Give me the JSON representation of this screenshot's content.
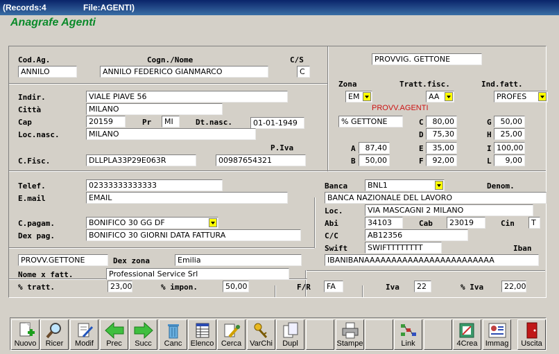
{
  "window": {
    "records": "(Records:4",
    "file": "File:AGENTI)"
  },
  "app_title": "Anagrafe Agenti",
  "labels": {
    "cod_ag": "Cod.Ag.",
    "cognome_nome": "Cogn./Nome",
    "cs": "C/S",
    "indir": "Indir.",
    "citta": "Città",
    "cap": "Cap",
    "pr": "Pr",
    "dt_nasc": "Dt.nasc.",
    "loc_nasc": "Loc.nasc.",
    "piva": "P.Iva",
    "cfisc": "C.Fisc.",
    "telef": "Telef.",
    "email": "E.mail",
    "cpagam": "C.pagam.",
    "dex_pag": "Dex pag.",
    "dex_zona": "Dex zona",
    "nome_fatt": "Nome x fatt.",
    "tratt": "% tratt.",
    "impon": "% impon.",
    "fr": "F/R",
    "iva": "Iva",
    "perc_iva": "% Iva",
    "zona": "Zona",
    "tratt_fisc": "Tratt.fisc.",
    "ind_fatt": "Ind.fatt.",
    "provv_agenti": "PROVV.AGENTI",
    "A": "A",
    "B": "B",
    "C": "C",
    "D": "D",
    "E": "E",
    "F": "F",
    "G": "G",
    "H": "H",
    "I": "I",
    "L": "L",
    "banca": "Banca",
    "denom": "Denom.",
    "loc": "Loc.",
    "abi": "Abi",
    "cab": "Cab",
    "cin": "Cin",
    "cc": "C/C",
    "swift": "Swift",
    "iban": "Iban"
  },
  "fields": {
    "cod_ag": "ANNILO",
    "cognome_nome": "ANNILO FEDERICO GIANMARCO",
    "cs": "C",
    "indir": "VIALE PIAVE 56",
    "citta": "MILANO",
    "cap": "20159",
    "pr": "MI",
    "dt_nasc": "01-01-1949",
    "loc_nasc": "MILANO",
    "cfisc": "DLLPLA33P29E063R",
    "piva": "00987654321",
    "telef": "02333333333333",
    "email": "EMAIL",
    "cpagam": "BONIFICO 30 GG DF",
    "dex_pag": "BONIFICO 30 GIORNI DATA FATTURA",
    "provv": "PROVV.GETTONE",
    "dex_zona": "Emilia",
    "nome_fatt": "Professional Service Srl",
    "tratt": "23,00",
    "impon": "50,00",
    "fr": "FA",
    "iva": "22",
    "perc_iva": "22,00",
    "provvig": "PROVVIG. GETTONE",
    "zona": "EM",
    "tratt_fisc": "AA",
    "ind_fatt": "PROFES",
    "gettone": "% GETTONE",
    "A": "87,40",
    "B": "50,00",
    "C": "80,00",
    "D": "75,30",
    "E": "35,00",
    "F": "92,00",
    "G": "50,00",
    "H": "25,00",
    "I": "100,00",
    "L": "9,00",
    "banca": "BNL1",
    "banca_denom": "BANCA NAZIONALE DEL LAVORO",
    "loc": "VIA MASCAGNI 2  MILANO",
    "abi": "34103",
    "cab": "23019",
    "cin": "T",
    "cc": "AB12356",
    "swift": "SWIFTTTTTTTT",
    "iban": "IBANIBANAAAAAAAAAAAAAAAAAAAAAAAA"
  },
  "toolbar": {
    "nuovo": "Nuovo",
    "ricer": "Ricer",
    "modif": "Modif",
    "prec": "Prec",
    "succ": "Succ",
    "canc": "Canc",
    "elenco": "Elenco",
    "cerca": "Cerca",
    "varchi": "VarChi",
    "dupl": "Dupl",
    "stampe": "Stampe",
    "link": "Link",
    "crea4": "4Crea",
    "immag": "Immag",
    "uscita": "Uscita"
  },
  "colors": {
    "title_bar": "#0a246a",
    "app_title": "#0a8a2a",
    "dropdown": "#ffff00",
    "red_label": "#cc1111"
  }
}
